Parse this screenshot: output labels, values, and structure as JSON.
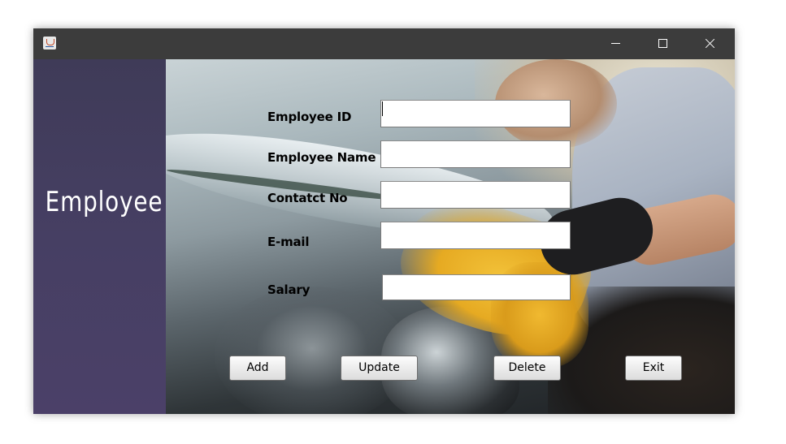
{
  "window": {
    "icon": "java-cup-icon",
    "controls": {
      "minimize": "minimize-icon",
      "maximize": "maximize-icon",
      "close": "close-icon"
    }
  },
  "sidebar": {
    "title": "Employee"
  },
  "form": {
    "fields": [
      {
        "label": "Employee ID",
        "value": ""
      },
      {
        "label": "Employee Name",
        "value": ""
      },
      {
        "label": "Contatct No",
        "value": ""
      },
      {
        "label": "E-mail",
        "value": ""
      },
      {
        "label": "Salary",
        "value": ""
      }
    ]
  },
  "buttons": {
    "add": "Add",
    "update": "Update",
    "delete": "Delete",
    "exit": "Exit"
  },
  "colors": {
    "titlebar": "#3c3c3c",
    "sidebar": "#463f63",
    "sidebar_text": "#ffffff"
  }
}
